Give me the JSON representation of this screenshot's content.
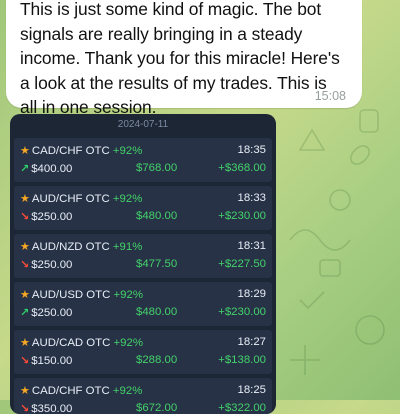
{
  "message": {
    "text": "This is just some kind of magic. The bot signals are really bringing in a steady income. Thank you for this miracle! Here's a look at the results of my trades. This is all in one session.",
    "time": "15:08"
  },
  "card": {
    "date": "2024-07-11",
    "trades": [
      {
        "pair": "CAD/CHF OTC",
        "pct": "+92%",
        "time": "18:35",
        "amount": "$400.00",
        "payout": "$768.00",
        "profit": "+$368.00",
        "direction": "up",
        "arrow": "↗"
      },
      {
        "pair": "AUD/CHF OTC",
        "pct": "+92%",
        "time": "18:33",
        "amount": "$250.00",
        "payout": "$480.00",
        "profit": "+$230.00",
        "direction": "down",
        "arrow": "↘"
      },
      {
        "pair": "AUD/NZD OTC",
        "pct": "+91%",
        "time": "18:31",
        "amount": "$250.00",
        "payout": "$477.50",
        "profit": "+$227.50",
        "direction": "down",
        "arrow": "↘"
      },
      {
        "pair": "AUD/USD OTC",
        "pct": "+92%",
        "time": "18:29",
        "amount": "$250.00",
        "payout": "$480.00",
        "profit": "+$230.00",
        "direction": "up",
        "arrow": "↗"
      },
      {
        "pair": "AUD/CAD OTC",
        "pct": "+92%",
        "time": "18:27",
        "amount": "$150.00",
        "payout": "$288.00",
        "profit": "+$138.00",
        "direction": "down",
        "arrow": "↘"
      },
      {
        "pair": "CAD/CHF OTC",
        "pct": "+92%",
        "time": "18:25",
        "amount": "$350.00",
        "payout": "$672.00",
        "profit": "+$322.00",
        "direction": "down",
        "arrow": "↘"
      }
    ]
  },
  "colors": {
    "card_bg": "#1d2634",
    "row_bg": "#273246",
    "profit_green": "#43d26a",
    "loss_red": "#ff4b3a",
    "star": "#f5a623"
  },
  "icons": {
    "star": "star-icon",
    "up": "arrow-up-right-icon",
    "down": "arrow-down-right-icon"
  }
}
